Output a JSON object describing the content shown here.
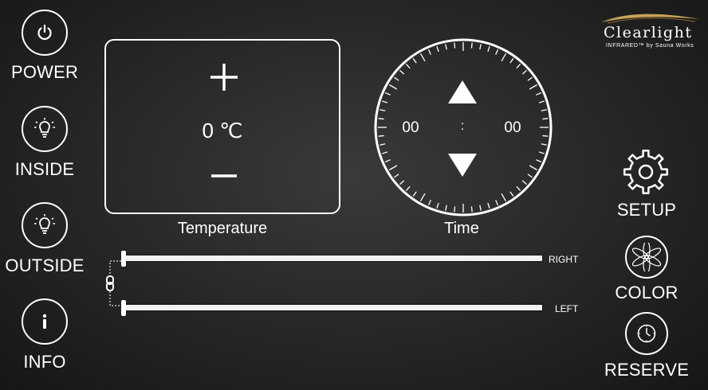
{
  "brand": {
    "name": "Clearlight",
    "tagline": "INFRARED™ by Sauna Works"
  },
  "left_menu": [
    {
      "label": "POWER",
      "icon": "power-icon"
    },
    {
      "label": "INSIDE",
      "icon": "lightbulb-icon"
    },
    {
      "label": "OUTSIDE",
      "icon": "lightbulb-icon"
    },
    {
      "label": "INFO",
      "icon": "info-icon"
    }
  ],
  "right_menu": [
    {
      "label": "SETUP",
      "icon": "gear-icon"
    },
    {
      "label": "COLOR",
      "icon": "flower-icon"
    },
    {
      "label": "RESERVE",
      "icon": "clock-icon"
    }
  ],
  "temperature": {
    "increase_symbol": "+",
    "value": "0 ℃",
    "decrease_symbol": "−",
    "label": "Temperature"
  },
  "time": {
    "hours": "00",
    "separator": ":",
    "minutes": "00",
    "label": "Time"
  },
  "sliders": {
    "right_label": "RIGHT",
    "left_label": "LEFT",
    "right_level": 0,
    "left_level": 0
  },
  "colors": {
    "foreground": "#ffffff",
    "logo_gold": "#c9a35a"
  }
}
